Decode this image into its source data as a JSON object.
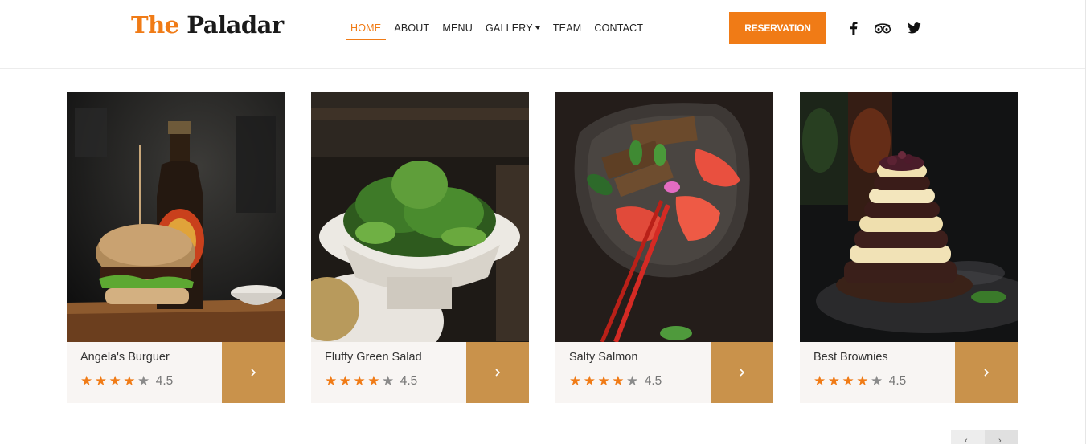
{
  "brand": {
    "part1": "The",
    "part2": "Paladar"
  },
  "nav": {
    "home": "HOME",
    "about": "ABOUT",
    "menu": "MENU",
    "gallery": "GALLERY",
    "team": "TEAM",
    "contact": "CONTACT"
  },
  "reservation_label": "RESERVATION",
  "social_icons": [
    "facebook-icon",
    "tripadvisor-icon",
    "twitter-icon"
  ],
  "colors": {
    "accent": "#f07b16",
    "card_button": "#c9924b",
    "card_info_bg": "#f8f5f3"
  },
  "dishes": [
    {
      "name": "Angela's Burguer",
      "rating": "4.5",
      "stars": 4.5
    },
    {
      "name": "Fluffy Green Salad",
      "rating": "4.5",
      "stars": 4.5
    },
    {
      "name": "Salty Salmon",
      "rating": "4.5",
      "stars": 4.5
    },
    {
      "name": "Best Brownies",
      "rating": "4.5",
      "stars": 4.5
    }
  ]
}
